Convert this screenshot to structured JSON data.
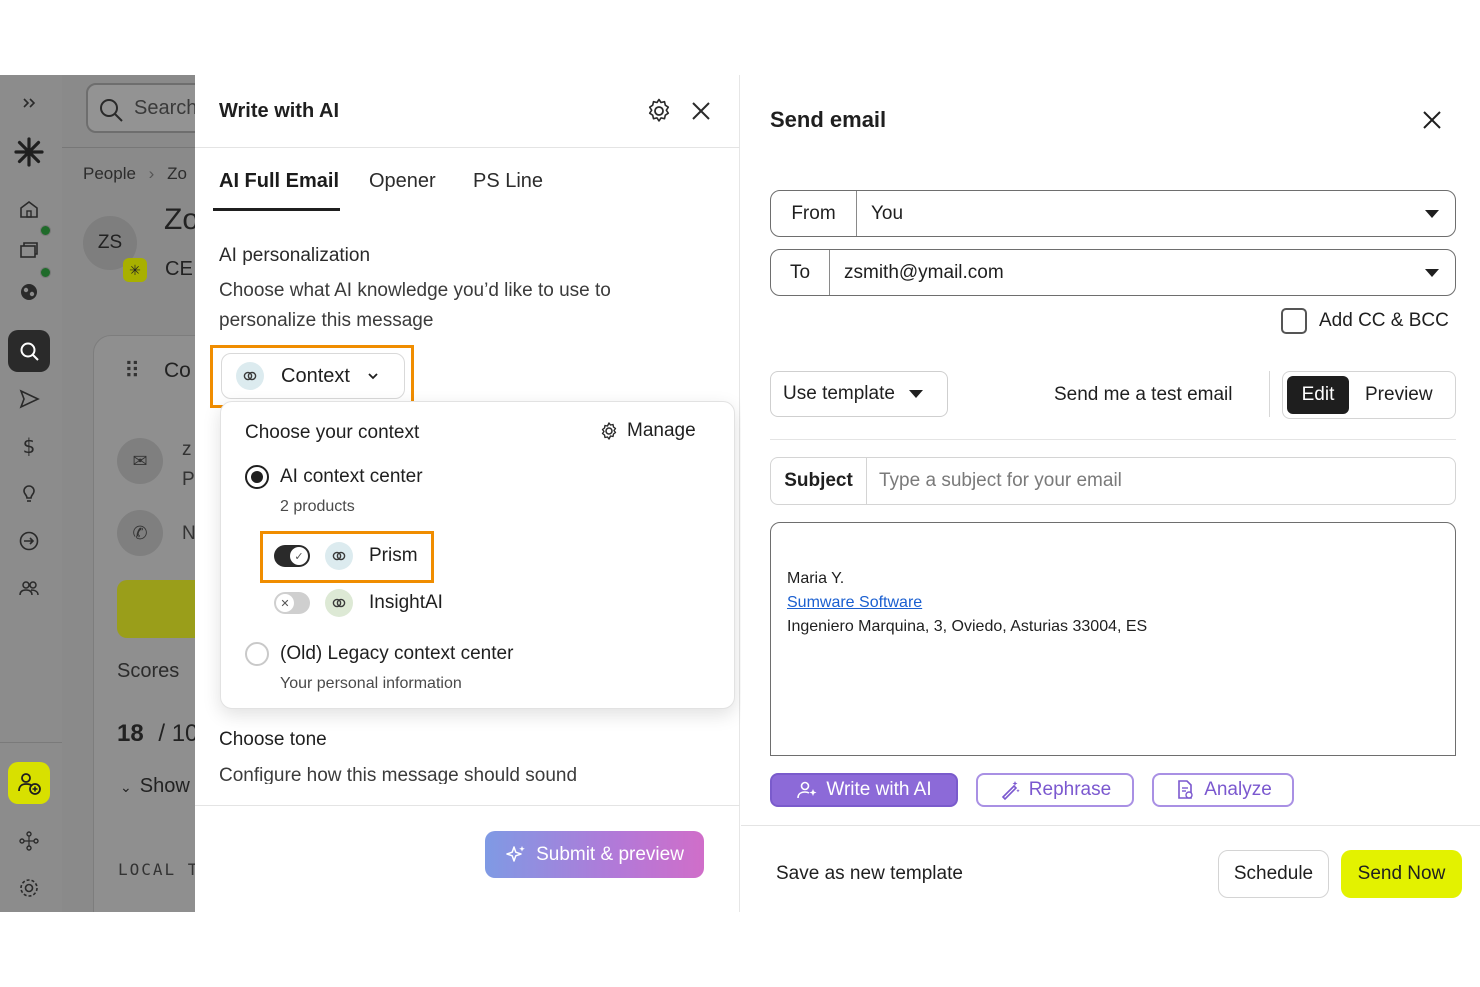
{
  "background_app": {
    "search_placeholder": "Search",
    "breadcrumb_people": "People",
    "breadcrumb_chevron": "›",
    "breadcrumb_current": "Zo",
    "avatar_initials": "ZS",
    "contact_name": "Zo",
    "contact_title": "CE",
    "card_title": "Co",
    "card_row1": "z",
    "card_row1_sub": "P",
    "card_row2": "N",
    "scores_label": "Scores",
    "score_value": "18",
    "score_total": "/ 10",
    "show_label": "Show",
    "local_time_label": "LOCAL T"
  },
  "ai_panel": {
    "title": "Write with AI",
    "tabs": [
      {
        "label": "AI Full Email",
        "active": true
      },
      {
        "label": "Opener",
        "active": false
      },
      {
        "label": "PS Line",
        "active": false
      }
    ],
    "personalization_heading": "AI personalization",
    "personalization_desc_line1": "Choose what AI knowledge you’d like to use to",
    "personalization_desc_line2": "personalize this message",
    "context_button_label": "Context",
    "dropdown": {
      "heading": "Choose your context",
      "manage_label": "Manage",
      "options": [
        {
          "label": "AI context center",
          "sub": "2 products",
          "selected": true
        },
        {
          "label": "(Old) Legacy context center",
          "sub": "Your personal information",
          "selected": false
        }
      ],
      "products": [
        {
          "name": "Prism",
          "enabled": true
        },
        {
          "name": "InsightAI",
          "enabled": false
        }
      ]
    },
    "tone_heading": "Choose tone",
    "tone_desc": "Configure how this message should sound",
    "submit_label": "Submit & preview"
  },
  "send_email": {
    "title": "Send email",
    "from_label": "From",
    "from_value": "You",
    "to_label": "To",
    "to_value": "zsmith@ymail.com",
    "cc_bcc_label": "Add CC & BCC",
    "use_template_label": "Use template",
    "test_email_label": "Send me a test email",
    "edit_label": "Edit",
    "preview_label": "Preview",
    "subject_label": "Subject",
    "subject_placeholder": "Type a subject for your email",
    "signature": {
      "name": "Maria Y.",
      "company": "Sumware Software",
      "address": "Ingeniero Marquina, 3, Oviedo, Asturias 33004, ES"
    },
    "write_ai_label": "Write with AI",
    "rephrase_label": "Rephrase",
    "analyze_label": "Analyze",
    "save_template_label": "Save as new template",
    "schedule_label": "Schedule",
    "send_now_label": "Send Now"
  },
  "colors": {
    "highlight_orange": "#f08d00",
    "send_now_yellow": "#e3f200",
    "ai_purple": "#8c6ad8",
    "overlay_gray": "#8a8a8a"
  }
}
